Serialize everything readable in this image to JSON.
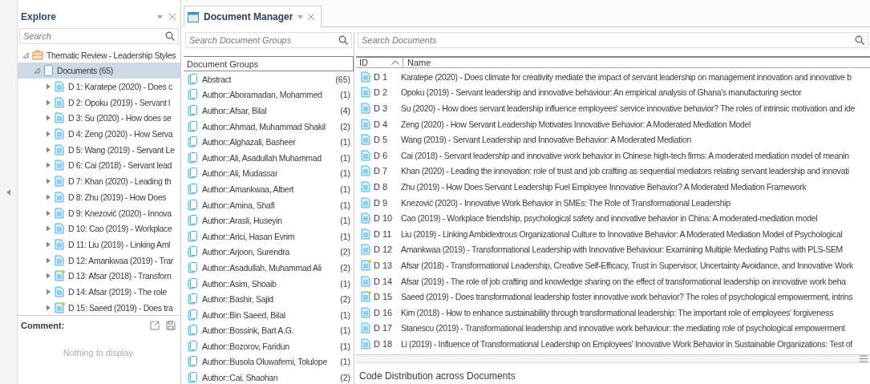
{
  "explore": {
    "title": "Explore",
    "search": {
      "placeholder": "Search"
    },
    "tree": [
      {
        "label": "Thematic Review - Leadership Styles",
        "kind": "project",
        "expanded": true,
        "selected": false,
        "children": [
          {
            "label": "Documents (65)",
            "kind": "folder",
            "expanded": true,
            "selected": true,
            "children": [
              {
                "label": "D 1: Karatepe (2020) - Does c",
                "kind": "document",
                "expanded": false,
                "selected": false,
                "commented": false
              },
              {
                "label": "D 2: Opoku (2019) - Servant l",
                "kind": "document",
                "expanded": false,
                "selected": false,
                "commented": false
              },
              {
                "label": "D 3: Su (2020) - How does se",
                "kind": "document",
                "expanded": false,
                "selected": false,
                "commented": false
              },
              {
                "label": "D 4: Zeng (2020) - How Serva",
                "kind": "document",
                "expanded": false,
                "selected": false,
                "commented": false
              },
              {
                "label": "D 5: Wang (2019) - Servant Le",
                "kind": "document",
                "expanded": false,
                "selected": false,
                "commented": false
              },
              {
                "label": "D 6: Cai (2018) - Servant lead",
                "kind": "document",
                "expanded": false,
                "selected": false,
                "commented": false
              },
              {
                "label": "D 7: Khan (2020) - Leading th",
                "kind": "document",
                "expanded": false,
                "selected": false,
                "commented": false
              },
              {
                "label": "D 8: Zhu (2019) - How Does",
                "kind": "document",
                "expanded": false,
                "selected": false,
                "commented": false
              },
              {
                "label": "D 9: Knezović (2020) - Innova",
                "kind": "document",
                "expanded": false,
                "selected": false,
                "commented": false
              },
              {
                "label": "D 10: Cao (2019) - Workplace",
                "kind": "document",
                "expanded": false,
                "selected": false,
                "commented": false
              },
              {
                "label": "D 11: Liu (2019) - Linking Aml",
                "kind": "document",
                "expanded": false,
                "selected": false,
                "commented": false
              },
              {
                "label": "D 12: Amankwaa (2019) - Trar",
                "kind": "document",
                "expanded": false,
                "selected": false,
                "commented": false
              },
              {
                "label": "D 13: Afsar (2018) - Transforn",
                "kind": "document",
                "expanded": false,
                "selected": false,
                "commented": true
              },
              {
                "label": "D 14: Afsar (2019) - The role",
                "kind": "document",
                "expanded": false,
                "selected": false,
                "commented": false
              },
              {
                "label": "D 15: Saeed (2019) - Does tra",
                "kind": "document",
                "expanded": false,
                "selected": false,
                "commented": true
              }
            ]
          }
        ]
      }
    ],
    "comment": {
      "title": "Comment:",
      "empty_text": "Nothing to display."
    }
  },
  "document_manager": {
    "tab": {
      "title": "Document Manager"
    },
    "groups": {
      "search": {
        "placeholder": "Search Document Groups"
      },
      "header": "Document Groups",
      "items": [
        {
          "name": "Abstract",
          "count": "(65)"
        },
        {
          "name": "Author::Aboramadan, Mohammed",
          "count": "(1)"
        },
        {
          "name": "Author::Afsar, Bilal",
          "count": "(4)"
        },
        {
          "name": "Author::Ahmad, Muhammad Shakil",
          "count": "(2)"
        },
        {
          "name": "Author::Alghazali, Basheer",
          "count": "(1)"
        },
        {
          "name": "Author::Ali, Asadullah Muhammad",
          "count": "(1)"
        },
        {
          "name": "Author::Ali, Mudassar",
          "count": "(1)"
        },
        {
          "name": "Author::Amankwaa, Albert",
          "count": "(1)"
        },
        {
          "name": "Author::Amina, Shafi",
          "count": "(1)"
        },
        {
          "name": "Author::Arasli, Huseyin",
          "count": "(1)"
        },
        {
          "name": "Author::Arici, Hasan Evrim",
          "count": "(1)"
        },
        {
          "name": "Author::Arjoon, Surendra",
          "count": "(2)"
        },
        {
          "name": "Author::Asadullah, Muhammad Ali",
          "count": "(2)"
        },
        {
          "name": "Author::Asim, Shoaib",
          "count": "(1)"
        },
        {
          "name": "Author::Bashir, Sajid",
          "count": "(2)"
        },
        {
          "name": "Author::Bin Saeed, Bilal",
          "count": "(1)"
        },
        {
          "name": "Author::Bossink, Bart A.G.",
          "count": "(1)"
        },
        {
          "name": "Author::Bozorov, Faridun",
          "count": "(1)"
        },
        {
          "name": "Author::Busola Oluwafemi, Tolulope",
          "count": "(1)"
        },
        {
          "name": "Author::Cai, Shaohan",
          "count": "(2)"
        }
      ]
    },
    "documents": {
      "search": {
        "placeholder": "Search Documents"
      },
      "columns": [
        {
          "label": "ID",
          "sorted": true
        },
        {
          "label": "Name",
          "sorted": false
        }
      ],
      "rows": [
        {
          "id": "D 1",
          "name": "Karatepe (2020) - Does climate for creativity mediate the impact of servant leadership on management innovation and innovative b",
          "commented": false
        },
        {
          "id": "D 2",
          "name": "Opoku (2019) - Servant leadership and innovative behaviour: An empirical analysis of Ghana's manufacturing sector",
          "commented": false
        },
        {
          "id": "D 3",
          "name": "Su (2020) - How does servant leadership influence employees' service innovative behavior? The roles of intrinsic motivation and ide",
          "commented": false
        },
        {
          "id": "D 4",
          "name": "Zeng (2020) - How Servant Leadership Motivates Innovative Behavior: A Moderated Mediation Model",
          "commented": false
        },
        {
          "id": "D 5",
          "name": "Wang (2019) - Servant Leadership and Innovative Behavior: A Moderated Mediation",
          "commented": false
        },
        {
          "id": "D 6",
          "name": "Cai (2018) - Servant leadership and innovative work behavior in Chinese high-tech firms: A moderated mediation model of meanin",
          "commented": false
        },
        {
          "id": "D 7",
          "name": "Khan (2020) - Leading the innovation: role of trust and job crafting as sequential mediators relating servant leadership and innovati",
          "commented": false
        },
        {
          "id": "D 8",
          "name": "Zhu (2019) - How Does Servant Leadership Fuel Employee Innovative Behavior? A Moderated Mediation Framework",
          "commented": false
        },
        {
          "id": "D 9",
          "name": "Knezović (2020) - Innovative Work Behavior in SMEs: The Role of Transformational Leadership",
          "commented": false
        },
        {
          "id": "D 10",
          "name": "Cao (2019) - Workplace friendship, psychological safety and innovative behavior in China: A moderated-mediation model",
          "commented": false
        },
        {
          "id": "D 11",
          "name": "Liu (2019) - Linking Ambidextrous Organizational Culture to Innovative Behavior: A Moderated Mediation Model of Psychological",
          "commented": false
        },
        {
          "id": "D 12",
          "name": "Amankwaa (2019) - Transformational Leadership with Innovative Behaviour: Examining Multiple Mediating Paths with PLS-SEM",
          "commented": false
        },
        {
          "id": "D 13",
          "name": "Afsar (2018) - Transformational Leadership, Creative Self-Efficacy, Trust in Supervisor, Uncertainty Avoidance, and Innovative Work",
          "commented": true
        },
        {
          "id": "D 14",
          "name": "Afsar (2019) - The role of job crafting and knowledge sharing on the effect of transformational leadership on innovative work beha",
          "commented": false
        },
        {
          "id": "D 15",
          "name": "Saeed (2019) - Does transformational leadership foster innovative work behavior? The roles of psychological empowerment, intrins",
          "commented": true
        },
        {
          "id": "D 16",
          "name": "Kim (2018) - How to enhance sustainability through transformational leadership: The important role of employees' forgiveness",
          "commented": false
        },
        {
          "id": "D 17",
          "name": "Stanescu (2019) - Transformational leadership and innovative work behaviour: the mediating role of psychological empowerment",
          "commented": false
        },
        {
          "id": "D 18",
          "name": "Li (2019) - Influence of Transformational Leadership on Employees' Innovative Work Behavior in Sustainable Organizations: Test of",
          "commented": false
        }
      ]
    },
    "code_distribution": {
      "title": "Code Distribution across Documents"
    }
  }
}
